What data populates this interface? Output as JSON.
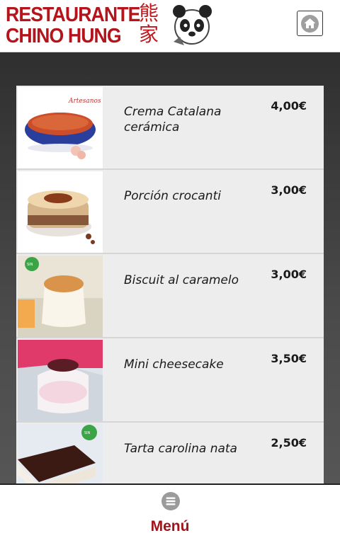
{
  "header": {
    "logo_line1": "RESTAURANTE",
    "logo_line2": "CHINO HUNG",
    "logo_cjk_top": "熊",
    "logo_cjk_bottom": "家",
    "home_icon": "home-icon"
  },
  "colors": {
    "brand_red": "#b4141b",
    "menu_red": "#a0151b",
    "item_bg": "#ededed"
  },
  "items": [
    {
      "name": "Crema Catalana cerámica",
      "price": "4,00€",
      "thumb_icon": "crema-catalana-image",
      "thumb_caption": "Artesanos"
    },
    {
      "name": "Porción crocanti",
      "price": "3,00€",
      "thumb_icon": "porcion-crocanti-image"
    },
    {
      "name": "Biscuit al caramelo",
      "price": "3,00€",
      "thumb_icon": "biscuit-caramelo-image",
      "badge": "Sin gluten"
    },
    {
      "name": "Mini cheesecake",
      "price": "3,50€",
      "thumb_icon": "mini-cheesecake-image"
    },
    {
      "name": "Tarta carolina nata",
      "price": "2,50€",
      "thumb_icon": "tarta-carolina-image",
      "badge": "Sin gluten"
    }
  ],
  "footer": {
    "menu_label": "Menú",
    "menu_icon": "hamburger-menu-icon"
  }
}
